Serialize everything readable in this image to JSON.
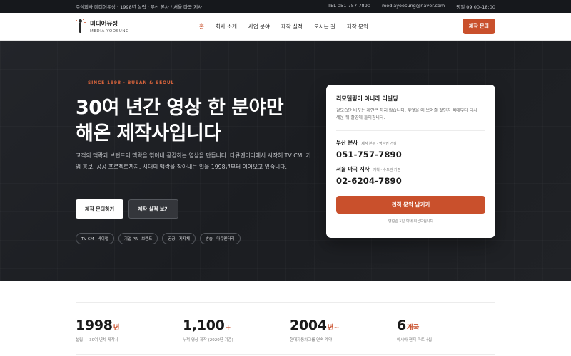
{
  "topbar": {
    "info": "주식회사 미디어유성 · 1998년 설립 · 부산 본사 / 서울 마곡 지사",
    "tel": "TEL 051-757-7890",
    "email": "mediayoosung@naver.com",
    "hours": "평일 09:00–18:00"
  },
  "header": {
    "logo_ko": "미디어유성",
    "logo_en": "MEDIA YOOSUNG",
    "nav": [
      "홈",
      "회사 소개",
      "사업 분야",
      "제작 실적",
      "오시는 길",
      "제작 문의"
    ],
    "cta": "제작 문의"
  },
  "hero": {
    "eyebrow": "SINCE 1998 · BUSAN & SEOUL",
    "title_line1": "30여 년간 영상 한 분야만",
    "title_line2": "해온 제작사입니다",
    "description": "고객의 맥락과 브랜드의 맥락을 엮어내 공감하는 영상을 만듭니다. 다큐멘터리에서 시작해 TV CM, 기업 홍보, 공공 프로젝트까지. 시대의 맥락을 잡아내는 일을 1998년부터 이어오고 있습니다.",
    "primary_button": "제작 문의하기",
    "secondary_button": "제작 실적 보기",
    "tags": [
      "TV CM · 바이럴",
      "기업 PR · 브랜드",
      "공공 · 지자체",
      "방송 · 다큐멘터리"
    ]
  },
  "card": {
    "title": "리모델링이 아니라 리빌딩",
    "subtitle": "겉모습만 바꾸는 제안은 하지 않습니다. 무엇을 왜 보여줄 것인지 뼈대부터 다시 세운 뒤 촬영에 들어갑니다.",
    "offices": [
      {
        "name": "부산 본사",
        "note": "제작 본부 · 영남권 거점",
        "phone": "051-757-7890"
      },
      {
        "name": "서울 마곡 지사",
        "note": "기획 · 수도권 거점",
        "phone": "02-6204-7890"
      }
    ],
    "button": "견적 문의 남기기",
    "footnote": "영업일 1일 이내 회신드립니다"
  },
  "stats": [
    {
      "number": "1998",
      "unit": "년",
      "label": "설립 — 30여 년차 제작사"
    },
    {
      "number": "1,100",
      "unit": "+",
      "label": "누적 영상 제작 (2020년 기준)"
    },
    {
      "number": "2004",
      "unit": "년~",
      "label": "현대자동차그룹 연속 계약"
    },
    {
      "number": "6",
      "unit": "개국",
      "label": "아시아 현지 파트너십"
    }
  ],
  "colors": {
    "accent": "#c9502c",
    "hero_bg": "#1f2125"
  }
}
